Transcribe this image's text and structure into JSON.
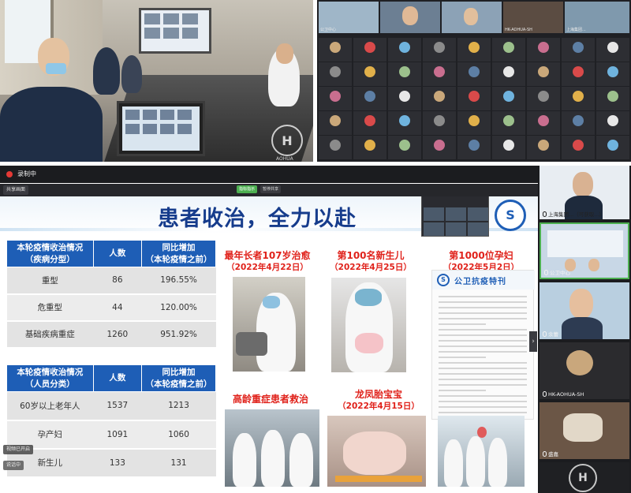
{
  "recording": {
    "label": "录制中"
  },
  "toolbar": {
    "shared_label": "共享画面",
    "pin_label": "指标指示",
    "pin_label2": "暂停共享"
  },
  "slide": {
    "title": "患者收治，全力以赴",
    "table1": {
      "headers": [
        "本轮疫情收治情况\n（疾病分型）",
        "人数",
        "同比增加\n（本轮疫情之前）"
      ],
      "rows": [
        [
          "重型",
          "86",
          "196.55%"
        ],
        [
          "危重型",
          "44",
          "120.00%"
        ],
        [
          "基础疾病重症",
          "1260",
          "951.92%"
        ]
      ]
    },
    "table2": {
      "headers": [
        "本轮疫情收治情况\n（人员分类）",
        "人数",
        "同比增加\n（本轮疫情之前）"
      ],
      "rows": [
        [
          "60岁以上老年人",
          "1537",
          "1213"
        ],
        [
          "孕产妇",
          "1091",
          "1060"
        ],
        [
          "新生儿",
          "133",
          "131"
        ]
      ]
    },
    "captions": {
      "oldest": {
        "title": "最年长者107岁治愈",
        "date": "（2022年4月22日）"
      },
      "newborn": {
        "title": "第100名新生儿",
        "date": "（2022年4月25日）"
      },
      "pregnant": {
        "title": "第1000位孕妇",
        "date": "（2022年5月2日）"
      },
      "elderly": {
        "title": "高龄重症患者救治"
      },
      "twins": {
        "title": "龙凤胎宝宝",
        "date": "（2022年4月15日）"
      }
    },
    "news_card": {
      "title": "公卫抗疫特刊",
      "logo": "S"
    },
    "seal": "S"
  },
  "overlay": {
    "btn1": "视频已开启",
    "btn2": "说话中"
  },
  "top_photo": {
    "watermark": "AOHUA"
  },
  "video_grid": {
    "top_tiles": [
      "公卫中心",
      "HK-AOHUA-SH",
      "上海集团..."
    ]
  },
  "sidebar": {
    "tiles": [
      {
        "name": "上海集团...（可获取...）"
      },
      {
        "name": "公卫中心"
      },
      {
        "name": "余蕾"
      },
      {
        "name": "HK-AOHUA-SH"
      },
      {
        "name": "盛嘉"
      }
    ]
  }
}
